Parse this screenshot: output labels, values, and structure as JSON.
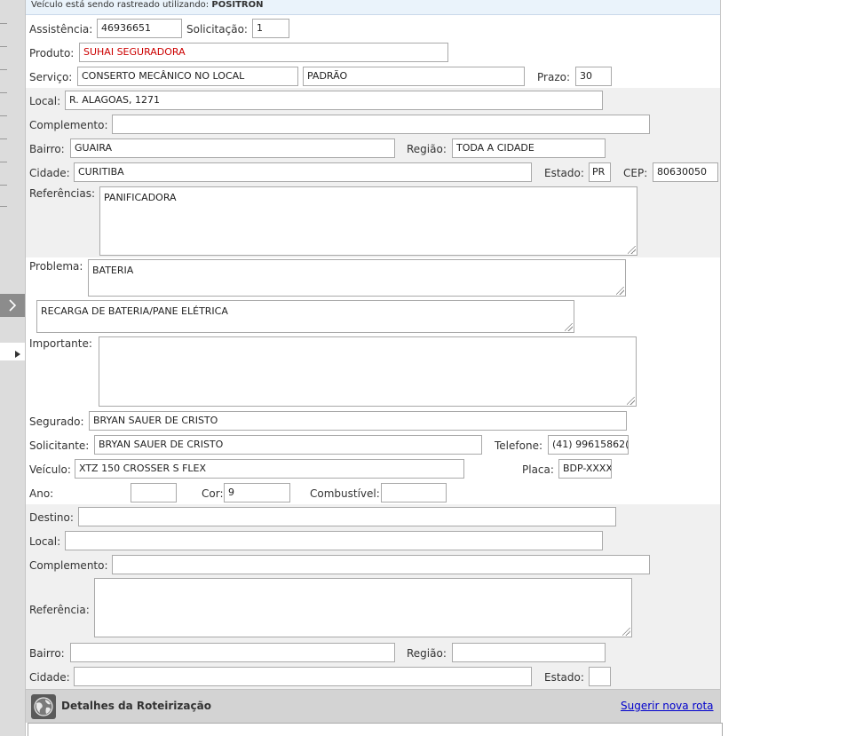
{
  "tracking": {
    "prefix": "Veículo está sendo rastreado utilizando:",
    "provider": "POSITRON"
  },
  "labels": {
    "assistencia": "Assistência:",
    "solicitacao": "Solicitação:",
    "produto": "Produto:",
    "servico": "Serviço:",
    "prazo": "Prazo:",
    "local": "Local:",
    "complemento": "Complemento:",
    "bairro": "Bairro:",
    "regiao": "Região:",
    "cidade": "Cidade:",
    "estado": "Estado:",
    "cep": "CEP:",
    "referencias": "Referências:",
    "problema": "Problema:",
    "importante": "Importante:",
    "segurado": "Segurado:",
    "solicitante": "Solicitante:",
    "telefone": "Telefone:",
    "veiculo": "Veículo:",
    "placa": "Placa:",
    "ano": "Ano:",
    "cor": "Cor:",
    "combustivel": "Combustível:",
    "destino": "Destino:",
    "referencia": "Referência:"
  },
  "values": {
    "assistencia": "46936651",
    "solicitacao": "1",
    "produto": "SUHAI SEGURADORA",
    "servico": "CONSERTO MECÂNICO NO LOCAL",
    "servico_tipo": "PADRÃO",
    "prazo": "30",
    "local": "R. ALAGOAS, 1271",
    "complemento": "",
    "bairro": "GUAIRA",
    "regiao": "TODA A CIDADE",
    "cidade": "CURITIBA",
    "estado": "PR",
    "cep": "80630050",
    "referencias": "PANIFICADORA",
    "problema": "BATERIA",
    "problema_detalhe": "RECARGA DE BATERIA/PANE ELÉTRICA",
    "importante": "",
    "segurado": "BRYAN SAUER DE CRISTO",
    "solicitante": "BRYAN SAUER DE CRISTO",
    "telefone": "(41) 99615862(",
    "veiculo": "XTZ 150 CROSSER S FLEX",
    "placa": "BDP-XXXX",
    "ano": "",
    "cor": "9",
    "combustivel": "",
    "destino": "",
    "destino_local": "",
    "destino_complemento": "",
    "destino_referencia": "",
    "destino_bairro": "",
    "destino_regiao": "",
    "destino_cidade": "",
    "destino_estado": ""
  },
  "routing": {
    "title": "Detalhes da Roteirização",
    "suggest_link": "Sugerir nova rota"
  },
  "icons": {
    "sidebar_toggle": "chevron-right-icon",
    "sidebar_arrow": "triangle-right-icon",
    "routing": "globe-icon"
  },
  "colors": {
    "produto_text": "#cc0000",
    "link": "#0000cc",
    "band_bg": "#f0f0f0",
    "routing_header_bg": "#d3d3d3"
  }
}
